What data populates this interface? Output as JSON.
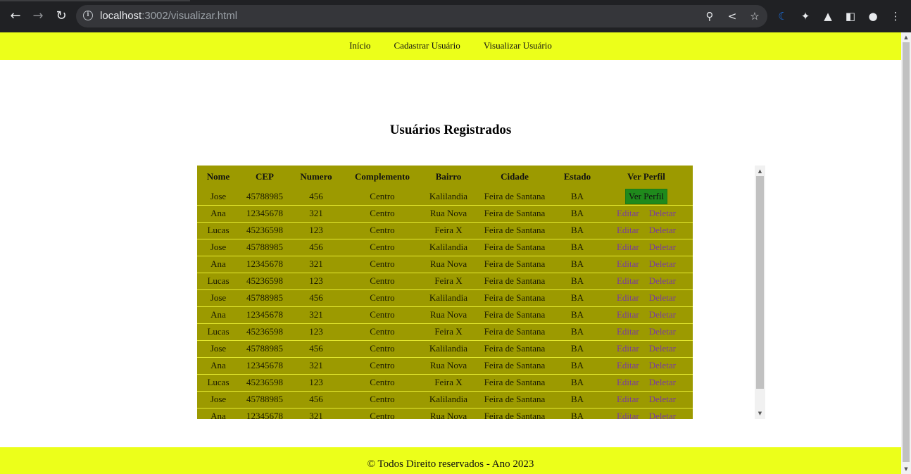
{
  "browser": {
    "url_host": "localhost",
    "url_rest": ":3002/visualizar.html"
  },
  "nav": {
    "items": [
      "Início",
      "Cadastrar Usuário",
      "Visualizar Usuário"
    ]
  },
  "main": {
    "title": "Usuários Registrados"
  },
  "table": {
    "headers": [
      "Nome",
      "CEP",
      "Numero",
      "Complemento",
      "Bairro",
      "Cidade",
      "Estado",
      "Ver Perfil"
    ],
    "first_row_action": "Ver Perfil",
    "edit_label": "Editar",
    "delete_label": "Deletar",
    "rows": [
      [
        "Jose",
        "45788985",
        "456",
        "Centro",
        "Kalilandia",
        "Feira de Santana",
        "BA"
      ],
      [
        "Ana",
        "12345678",
        "321",
        "Centro",
        "Rua Nova",
        "Feira de Santana",
        "BA"
      ],
      [
        "Lucas",
        "45236598",
        "123",
        "Centro",
        "Feira X",
        "Feira de Santana",
        "BA"
      ],
      [
        "Jose",
        "45788985",
        "456",
        "Centro",
        "Kalilandia",
        "Feira de Santana",
        "BA"
      ],
      [
        "Ana",
        "12345678",
        "321",
        "Centro",
        "Rua Nova",
        "Feira de Santana",
        "BA"
      ],
      [
        "Lucas",
        "45236598",
        "123",
        "Centro",
        "Feira X",
        "Feira de Santana",
        "BA"
      ],
      [
        "Jose",
        "45788985",
        "456",
        "Centro",
        "Kalilandia",
        "Feira de Santana",
        "BA"
      ],
      [
        "Ana",
        "12345678",
        "321",
        "Centro",
        "Rua Nova",
        "Feira de Santana",
        "BA"
      ],
      [
        "Lucas",
        "45236598",
        "123",
        "Centro",
        "Feira X",
        "Feira de Santana",
        "BA"
      ],
      [
        "Jose",
        "45788985",
        "456",
        "Centro",
        "Kalilandia",
        "Feira de Santana",
        "BA"
      ],
      [
        "Ana",
        "12345678",
        "321",
        "Centro",
        "Rua Nova",
        "Feira de Santana",
        "BA"
      ],
      [
        "Lucas",
        "45236598",
        "123",
        "Centro",
        "Feira X",
        "Feira de Santana",
        "BA"
      ],
      [
        "Jose",
        "45788985",
        "456",
        "Centro",
        "Kalilandia",
        "Feira de Santana",
        "BA"
      ],
      [
        "Ana",
        "12345678",
        "321",
        "Centro",
        "Rua Nova",
        "Feira de Santana",
        "BA"
      ]
    ]
  },
  "footer": {
    "text": "© Todos Direito reservados - Ano 2023"
  },
  "colors": {
    "nav_bg": "#ecff1a",
    "table_bg": "#9c9a00",
    "profile_button": "#1f8a1c",
    "action_link": "#7a3aa0"
  }
}
